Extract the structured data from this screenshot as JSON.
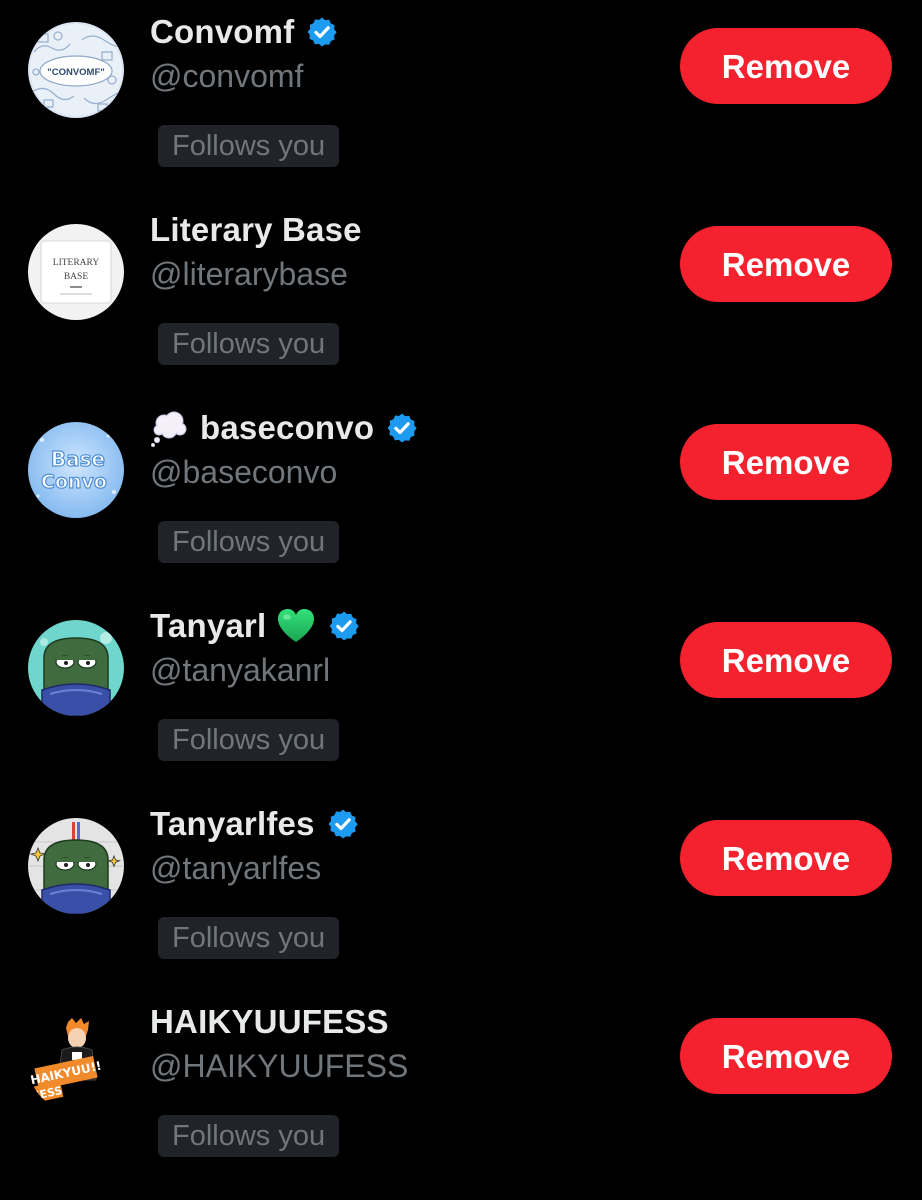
{
  "colors": {
    "background": "#000000",
    "name_text": "#e7e9ea",
    "muted_text": "#71767b",
    "badge_bg": "#202327",
    "remove_bg": "#f4212e",
    "remove_text": "#ffffff",
    "verified_blue": "#1d9bf0"
  },
  "icons": {
    "verified": "verified-badge-icon",
    "thought_bubble": "thought-balloon-emoji",
    "green_heart": "green-heart-emoji"
  },
  "followers": [
    {
      "display_name": "Convomf",
      "handle": "@convomf",
      "verified": true,
      "follows_label": "Follows you",
      "remove_label": "Remove",
      "avatar_text": "\"CONVOMF\""
    },
    {
      "display_name": "Literary Base",
      "handle": "@literarybase",
      "verified": false,
      "follows_label": "Follows you",
      "remove_label": "Remove",
      "avatar_text_1": "LITERARY",
      "avatar_text_2": "BASE"
    },
    {
      "display_name": "baseconvo",
      "handle": "@baseconvo",
      "verified": true,
      "name_prefix_emoji": "thought-balloon-emoji",
      "follows_label": "Follows you",
      "remove_label": "Remove",
      "avatar_text_1": "Base",
      "avatar_text_2": "Convo"
    },
    {
      "display_name": "Tanyarl",
      "handle": "@tanyakanrl",
      "verified": true,
      "name_suffix_emoji": "green-heart-emoji",
      "follows_label": "Follows you",
      "remove_label": "Remove"
    },
    {
      "display_name": "Tanyarlfes",
      "handle": "@tanyarlfes",
      "verified": true,
      "follows_label": "Follows you",
      "remove_label": "Remove"
    },
    {
      "display_name": "HAIKYUUFESS",
      "handle": "@HAIKYUUFESS",
      "verified": false,
      "follows_label": "Follows you",
      "remove_label": "Remove",
      "avatar_text_1": "HAIKYUU!!",
      "avatar_text_2": "FESS"
    }
  ]
}
